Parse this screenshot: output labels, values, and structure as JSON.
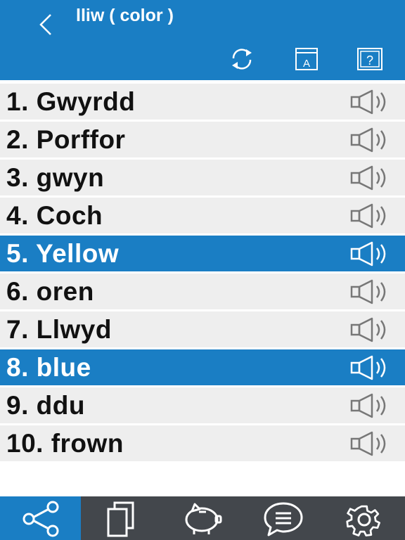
{
  "header": {
    "title": "lliw ( color )",
    "icons": [
      "back-icon",
      "refresh-icon",
      "dictionary-icon",
      "help-icon"
    ]
  },
  "words": [
    {
      "label": "1. Gwyrdd",
      "selected": false
    },
    {
      "label": "2. Porffor",
      "selected": false
    },
    {
      "label": "3. gwyn",
      "selected": false
    },
    {
      "label": "4. Coch",
      "selected": false
    },
    {
      "label": "5. Yellow",
      "selected": true
    },
    {
      "label": "6. oren",
      "selected": false
    },
    {
      "label": "7. Llwyd",
      "selected": false
    },
    {
      "label": "8. blue",
      "selected": true
    },
    {
      "label": "9. ddu",
      "selected": false
    },
    {
      "label": "10. frown",
      "selected": false
    }
  ],
  "tabbar": {
    "tabs": [
      "share-icon",
      "cards-icon",
      "piggy-bank-icon",
      "chat-icon",
      "settings-icon"
    ],
    "active": "share-icon"
  },
  "colors": {
    "accent": "#1a7ec4",
    "row_bg": "#eeeeee",
    "tabbar_bg": "#43474c"
  }
}
